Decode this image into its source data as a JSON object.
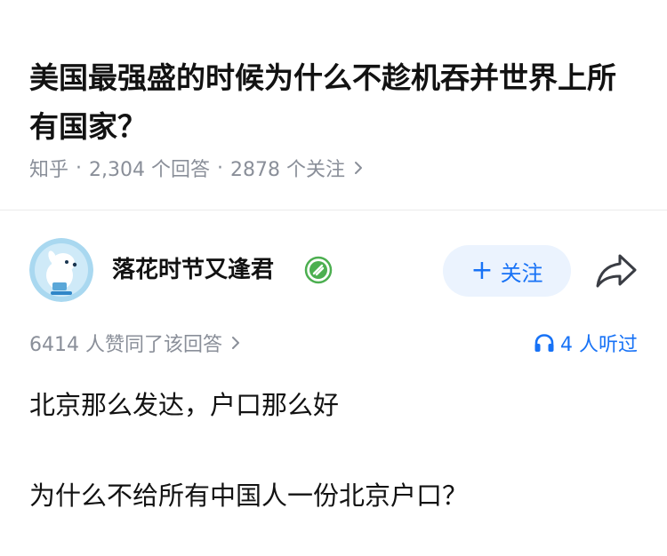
{
  "question": {
    "title": "美国最强盛的时候为什么不趁机吞并世界上所有国家？",
    "source": "知乎",
    "separator": "·",
    "answer_count": "2,304 个回答",
    "follower_count": "2878 个关注"
  },
  "author": {
    "name": "落花时节又逢君",
    "follow_label": "关注",
    "follow_prefix": "+"
  },
  "answer": {
    "votes": "6414 人赞同了该回答",
    "listeners": "4 人听过",
    "paragraphs": [
      "北京那么发达，户口那么好",
      "为什么不给所有中国人一份北京户口？"
    ]
  },
  "colors": {
    "accent": "#1772f6",
    "follow_bg": "#ebf3fe",
    "meta_text": "#8a8f99",
    "title_text": "#121212",
    "badge_green": "#4caf50",
    "avatar_bg": "#a9d8f0"
  },
  "icons": {
    "chevron": "chevron-right-icon",
    "badge": "verified-badge-icon",
    "share": "share-arrow-icon",
    "listen": "headphones-icon"
  }
}
